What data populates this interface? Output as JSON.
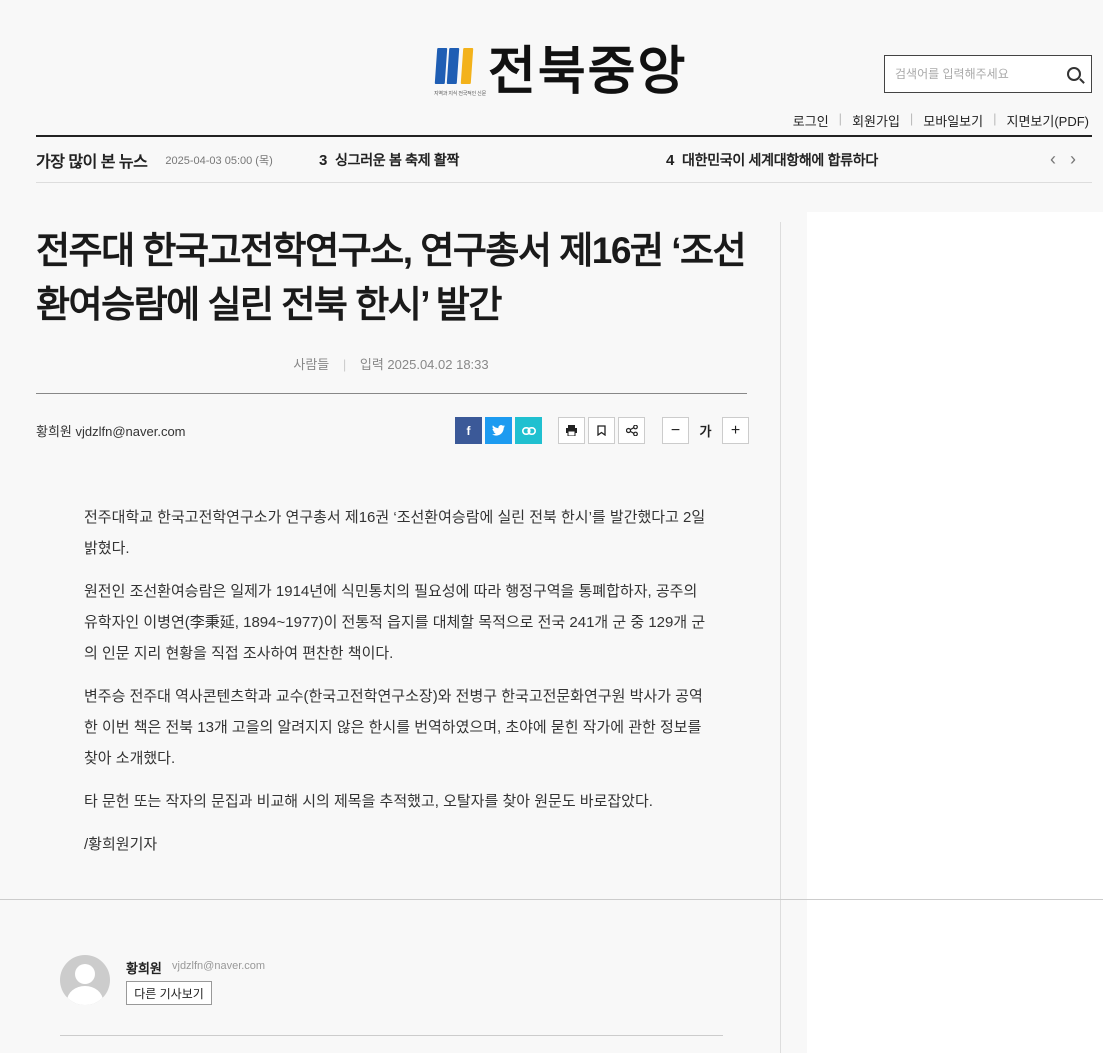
{
  "header": {
    "logo_text": "전북중앙",
    "logo_tagline": "지역과 지식 전국적인 신문",
    "search_placeholder": "검색어를 입력해주세요",
    "util_links": [
      "로그인",
      "회원가입",
      "모바일보기",
      "지면보기(PDF)"
    ]
  },
  "ticker": {
    "title": "가장 많이 본 뉴스",
    "date": "2025-04-03 05:00 (목)",
    "items": [
      {
        "rank": "3",
        "text": "싱그러운 봄 축제 활짝"
      },
      {
        "rank": "4",
        "text": "대한민국이 세계대항해에 합류하다"
      }
    ],
    "prev": "‹",
    "next": "›"
  },
  "article": {
    "headline": "전주대 한국고전학연구소, 연구총서 제16권 ‘조선환여승람에 실린 전북 한시’ 발간",
    "section": "사람들",
    "published": "입력 2025.04.02 18:33",
    "byline": "황희원 vjdzlfn@naver.com",
    "paragraphs": [
      "전주대학교 한국고전학연구소가 연구총서 제16권 ‘조선환여승람에 실린 전북 한시’를 발간했다고 2일 밝혔다.",
      "원전인 조선환여승람은 일제가 1914년에 식민통치의 필요성에 따라 행정구역을 통폐합하자, 공주의 유학자인 이병연(李秉延, 1894~1977)이 전통적 읍지를 대체할 목적으로 전국 241개 군 중 129개 군의 인문 지리 현황을 직접 조사하여 편찬한 책이다.",
      "변주승 전주대 역사콘텐츠학과 교수(한국고전학연구소장)와 전병구 한국고전문화연구원 박사가 공역한 이번 책은 전북 13개 고을의 알려지지 않은 한시를 번역하였으며, 초야에 묻힌 작가에 관한 정보를 찾아 소개했다.",
      "타 문헌 또는 작자의 문집과 비교해 시의 제목을 추적했고, 오탈자를 찾아 원문도 바로잡았다.",
      "/황희원기자"
    ]
  },
  "toolbar": {
    "facebook": "f",
    "twitter": "t",
    "font_minus": "−",
    "font_label": "가",
    "font_plus": "+"
  },
  "author": {
    "name": "황희원",
    "email": "vjdzlfn@naver.com",
    "more_button": "다른 기사보기"
  },
  "colors": {
    "facebook": "#3b5998",
    "twitter": "#1d9bf0",
    "link": "#20c0d0",
    "logo_blue": "#1f5eb4",
    "logo_yellow": "#f3b21b"
  }
}
